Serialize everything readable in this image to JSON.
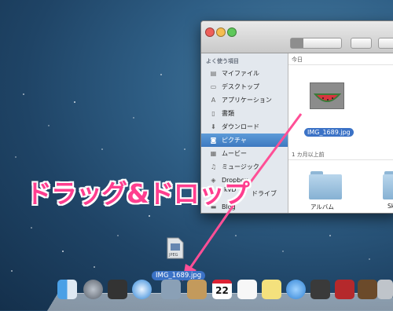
{
  "finder": {
    "sidebar_heading": "よく使う項目",
    "sidebar_items": [
      {
        "label": "マイファイル",
        "icon": "all-files-icon"
      },
      {
        "label": "デスクトップ",
        "icon": "desktop-icon"
      },
      {
        "label": "アプリケーション",
        "icon": "applications-icon"
      },
      {
        "label": "書類",
        "icon": "documents-icon"
      },
      {
        "label": "ダウンロード",
        "icon": "downloads-icon"
      },
      {
        "label": "ピクチャ",
        "icon": "pictures-icon",
        "selected": true
      },
      {
        "label": "ムービー",
        "icon": "movies-icon"
      },
      {
        "label": "ミュージック",
        "icon": "music-icon"
      },
      {
        "label": "Dropbox",
        "icon": "dropbox-icon"
      },
      {
        "label": "ドライブ",
        "icon": "drive-icon"
      },
      {
        "label": "Blog",
        "icon": "folder-icon"
      }
    ],
    "section_today": "今日",
    "section_older": "1 カ月以上前",
    "selected_file": "IMG_1689.jpg",
    "folders": [
      {
        "label": "アルバム"
      },
      {
        "label": "Sk"
      }
    ]
  },
  "overlay": {
    "instruction": "ドラッグ&ドロップ",
    "sidebar_partial": "kvD",
    "drag_file_label": "IMG_1689.jpg",
    "ghost_type": "JPEG"
  },
  "dock_date": "22",
  "colors": {
    "accent_pink": "#ff3e8f",
    "selection_blue": "#3b72c6"
  }
}
